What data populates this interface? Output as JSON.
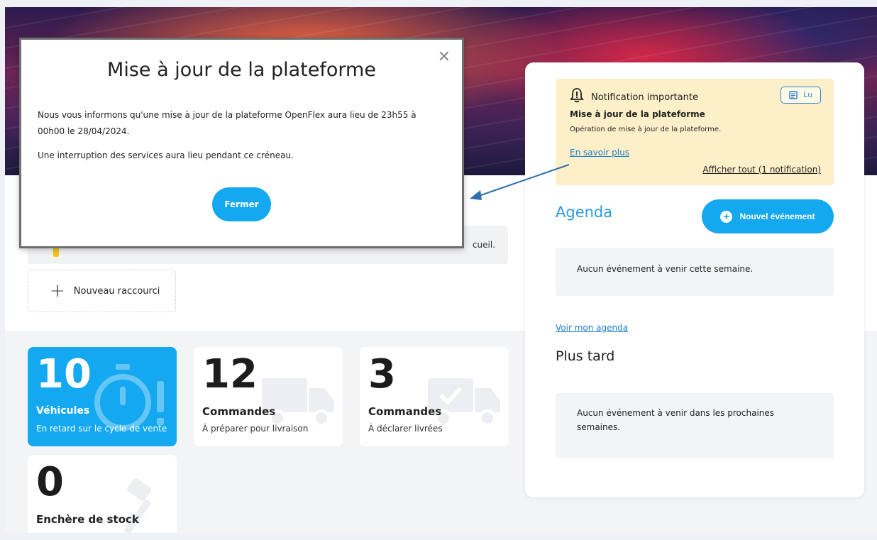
{
  "modal": {
    "title": "Mise à jour de la plateforme",
    "paragraph1": "Nous vous informons qu'une mise à jour de la plateforme OpenFlex aura lieu de 23h55 à 00h00 le 28/04/2024.",
    "paragraph2": "Une interruption des services aura lieu pendant ce créneau.",
    "close_button": "Fermer",
    "close_icon": "close-icon"
  },
  "shortcuts": {
    "bar_tail_text": "cueil.",
    "new_shortcut_label": "Nouveau raccourci"
  },
  "tiles": [
    {
      "count": "10",
      "title": "Véhicules",
      "subtitle": "En retard sur le cycle de vente",
      "icon": "stopwatch-alert-icon"
    },
    {
      "count": "12",
      "title": "Commandes",
      "subtitle": "À préparer pour livraison",
      "icon": "truck-icon"
    },
    {
      "count": "3",
      "title": "Commandes",
      "subtitle": "À déclarer livrées",
      "icon": "truck-check-icon"
    },
    {
      "count": "0",
      "title": "Enchère de stock",
      "subtitle": "",
      "icon": "gavel-icon"
    }
  ],
  "notification": {
    "label": "Notification importante",
    "read_button": "Lu",
    "heading": "Mise à jour de la plateforme",
    "description": "Opération de mise à jour de la plateforme.",
    "more_link": "En savoir plus",
    "show_all_link": "Afficher tout (1 notification)"
  },
  "agenda": {
    "title": "Agenda",
    "new_event_button": "Nouvel événement",
    "empty_week": "Aucun événement à venir cette semaine.",
    "view_link": "Voir mon agenda",
    "later_title": "Plus tard",
    "empty_later": "Aucun événement à venir dans les prochaines semaines."
  },
  "colors": {
    "accent": "#13a8f0",
    "link": "#1f7bc8",
    "notification_bg": "#fdf0c8",
    "agenda_title": "#2d9bdc"
  }
}
